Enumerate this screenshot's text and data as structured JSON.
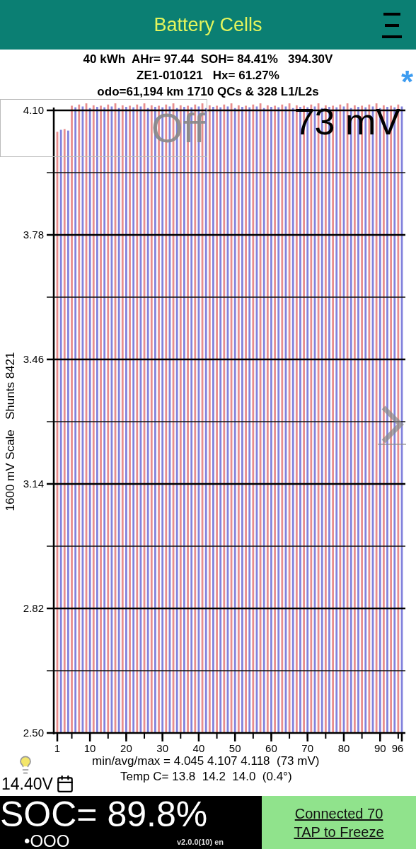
{
  "header": {
    "title": "Battery Cells"
  },
  "info_lines": [
    "40 kWh  AHr= 97.44  SOH= 84.41%   394.30V",
    "ZE1-010121   Hx= 61.27%",
    "odo=61,194 km 1710 QCs & 328 L1/L2s"
  ],
  "status_mark": "*",
  "chart": {
    "side_label": "1600 mV Scale   Shunts 8421",
    "balance_state": "Off",
    "spread": "73 mV",
    "chart_data": {
      "type": "bar",
      "grid": true,
      "xlim": [
        1,
        96
      ],
      "ylim": [
        2.5,
        4.12
      ],
      "yticks": [
        {
          "value": 2.5,
          "label": "2.50"
        },
        {
          "value": 2.82,
          "label": "2.82"
        },
        {
          "value": 3.14,
          "label": "3.14"
        },
        {
          "value": 3.46,
          "label": "3.46"
        },
        {
          "value": 3.78,
          "label": "3.78"
        },
        {
          "value": 4.1,
          "label": "4.10"
        }
      ],
      "xticks": [
        1,
        10,
        20,
        30,
        40,
        50,
        60,
        70,
        80,
        90,
        96
      ],
      "series": [
        {
          "color": "#e88e8e",
          "x": [
            1,
            3,
            5,
            7,
            9,
            11,
            13,
            15,
            17,
            19,
            21,
            23,
            25,
            27,
            29,
            31,
            33,
            35,
            37,
            39,
            41,
            43,
            45,
            47,
            49,
            51,
            53,
            55,
            57,
            59,
            61,
            63,
            65,
            67,
            69,
            71,
            73,
            75,
            77,
            79,
            81,
            83,
            85,
            87,
            89,
            91,
            93,
            95
          ],
          "values": [
            4.045,
            4.052,
            4.112,
            4.115,
            4.118,
            4.113,
            4.112,
            4.115,
            4.118,
            4.113,
            4.112,
            4.115,
            4.118,
            4.113,
            4.112,
            4.115,
            4.118,
            4.113,
            4.112,
            4.115,
            4.118,
            4.113,
            4.112,
            4.115,
            4.118,
            4.113,
            4.112,
            4.115,
            4.118,
            4.113,
            4.112,
            4.115,
            4.118,
            4.113,
            4.112,
            4.115,
            4.118,
            4.113,
            4.112,
            4.115,
            4.118,
            4.113,
            4.112,
            4.115,
            4.118,
            4.113,
            4.112,
            4.115
          ]
        },
        {
          "color": "#8282dc",
          "x": [
            2,
            4,
            6,
            8,
            10,
            12,
            14,
            16,
            18,
            20,
            22,
            24,
            26,
            28,
            30,
            32,
            34,
            36,
            38,
            40,
            42,
            44,
            46,
            48,
            50,
            52,
            54,
            56,
            58,
            60,
            62,
            64,
            66,
            68,
            70,
            72,
            74,
            76,
            78,
            80,
            82,
            84,
            86,
            88,
            90,
            92,
            94,
            96
          ],
          "values": [
            4.05,
            4.048,
            4.108,
            4.11,
            4.106,
            4.109,
            4.108,
            4.11,
            4.106,
            4.109,
            4.108,
            4.11,
            4.106,
            4.109,
            4.108,
            4.11,
            4.106,
            4.109,
            4.108,
            4.11,
            4.106,
            4.109,
            4.108,
            4.11,
            4.106,
            4.109,
            4.108,
            4.11,
            4.106,
            4.109,
            4.108,
            4.11,
            4.106,
            4.109,
            4.108,
            4.11,
            4.106,
            4.109,
            4.108,
            4.11,
            4.106,
            4.109,
            4.108,
            4.11,
            4.106,
            4.109,
            4.108,
            4.11
          ]
        }
      ]
    }
  },
  "stats": [
    "min/avg/max = 4.045 4.107 4.118  (73 mV)",
    "Temp C= 13.8  14.2  14.0  (0.4°)"
  ],
  "aux_battery": "14.40V",
  "soc": "SOC= 89.8%",
  "dots": "•OOO",
  "version": "v2.0.0(10) en",
  "connection": {
    "lines": [
      "Connected 70",
      "TAP to Freeze"
    ]
  }
}
